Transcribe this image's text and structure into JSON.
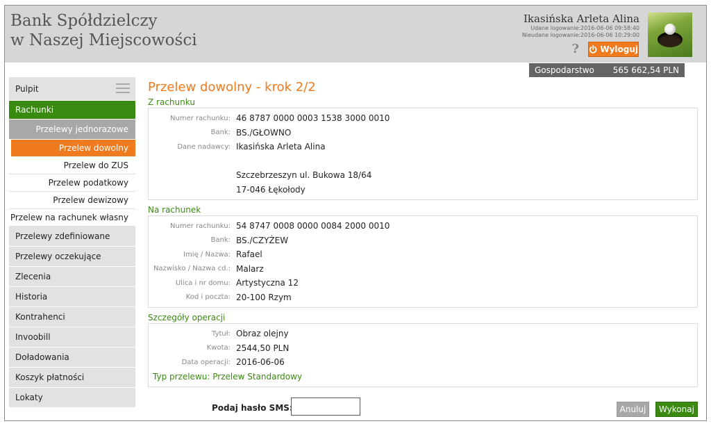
{
  "bank": {
    "name_line1": "Bank Spółdzielczy",
    "name_line2": "w Naszej Miejscowości"
  },
  "user": {
    "name": "Ikasińska Arleta Alina",
    "last_success_login": "Udane logowanie:2016-06-06 09:58:40",
    "last_failed_login": "Nieudane logowanie:2016-06-06 10:29:00",
    "help_label": "?",
    "logout_label": "Wyloguj",
    "avatar_icon": "golf-ball-icon"
  },
  "balance": {
    "account_name": "Gospodarstwo",
    "amount": "565 662,54 PLN"
  },
  "sidebar": {
    "pulpit": "Pulpit",
    "rachunki": "Rachunki",
    "group": "Przelewy jednorazowe",
    "sub_items": [
      "Przelew dowolny",
      "Przelew do ZUS",
      "Przelew podatkowy",
      "Przelew dewizowy",
      "Przelew na rachunek własny"
    ],
    "items": [
      "Przelewy zdefiniowane",
      "Przelewy oczekujące",
      "Zlecenia",
      "Historia",
      "Kontrahenci",
      "Invoobill",
      "Doładowania",
      "Koszyk płatności",
      "Lokaty"
    ]
  },
  "main": {
    "title": "Przelew dowolny - krok 2/2",
    "from": {
      "title": "Z rachunku",
      "account_label": "Numer rachunku:",
      "account": "46 8787 0000 0003 1538 3000 0010",
      "bank_label": "Bank:",
      "bank": "BS./GŁOWNO",
      "sender_label": "Dane nadawcy:",
      "sender_name": "Ikasińska Arleta Alina",
      "sender_address": "Szczebrzeszyn ul. Bukowa 18/64",
      "sender_city": "17-046 Łękołody"
    },
    "to": {
      "title": "Na rachunek",
      "account_label": "Numer rachunku:",
      "account": "54 8747 0008 0000 0084 2000 0010",
      "bank_label": "Bank:",
      "bank": "BS./CZYŻEW",
      "name_label": "Imię / Nazwa:",
      "name": "Rafael",
      "surname_label": "Nazwisko / Nazwa cd.:",
      "surname": "Malarz",
      "street_label": "Ulica i nr domu:",
      "street": "Artystyczna 12",
      "postal_label": "Kod i poczta:",
      "postal": "20-100 Rzym"
    },
    "details": {
      "title": "Szczegóły operacji",
      "title_label": "Tytuł:",
      "title_value": "Obraz olejny",
      "amount_label": "Kwota:",
      "amount": "2544,50 PLN",
      "date_label": "Data operacji:",
      "date": "2016-06-06",
      "type_line": "Typ przelewu: Przelew Standardowy"
    },
    "sms_label": "Podaj hasło SMS:",
    "sms_value": "",
    "cancel_label": "Anuluj",
    "execute_label": "Wykonaj"
  }
}
